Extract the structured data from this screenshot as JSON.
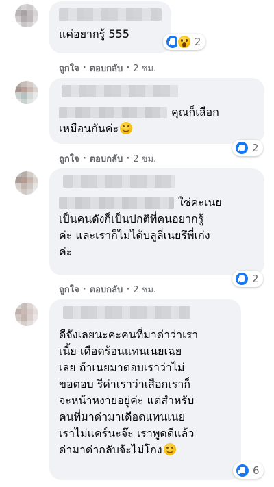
{
  "actions": {
    "like": "ถูกใจ",
    "reply": "ตอบกลับ",
    "separator": "·"
  },
  "colors": {
    "bubble": "#f0f2f5",
    "like_blue": "#1877f2",
    "meta_gray": "#65676b"
  },
  "comments": [
    {
      "lines": [
        "แค่อยากรู้ 555"
      ],
      "reaction_icons": [
        "like-icon",
        "wow-icon"
      ],
      "reaction_count": "2",
      "time": "2 ชม."
    },
    {
      "lines": [
        "คุณก็เลือก",
        "เหมือนกันค่ะ"
      ],
      "emoji": "smiling-face-emoji",
      "reaction_icons": [
        "like-icon"
      ],
      "reaction_count": "2",
      "time": "2 ชม."
    },
    {
      "lines": [
        "ใช่ค่ะเนย",
        "เป็นคนดังก็เป็นปกติที่คนอยากรู้",
        "ค่ะ และเราก็ไม่ได้บลูลี่เนยรึพี่เก่ง",
        "ค่ะ"
      ],
      "reaction_icons": [
        "like-icon"
      ],
      "reaction_count": "2",
      "time": "2 ชม."
    },
    {
      "lines": [
        "ดีจังเลยนะคะคนที่มาด่าว่าเรา",
        "เนี้ย เดือดร้อนแทนเนยเฉย",
        "เลย ถ้าเนยมาตอบเราว่าไม่",
        "ขอตอบ รีด่าเราว่าเสือกเราก็",
        "จะหน้าหงายอยู่ค่ะ แต่สำหรับ",
        "คนที่มาด่ามาเดือดแทนเนย",
        "เราไม่แคร์นะจ๊ะ เราพูดดีแล้ว",
        "ด่ามาด่ากลับจ้ะไม่โกง"
      ],
      "emoji": "smiling-face-emoji",
      "reaction_icons": [
        "like-icon"
      ],
      "reaction_count": "6"
    }
  ]
}
